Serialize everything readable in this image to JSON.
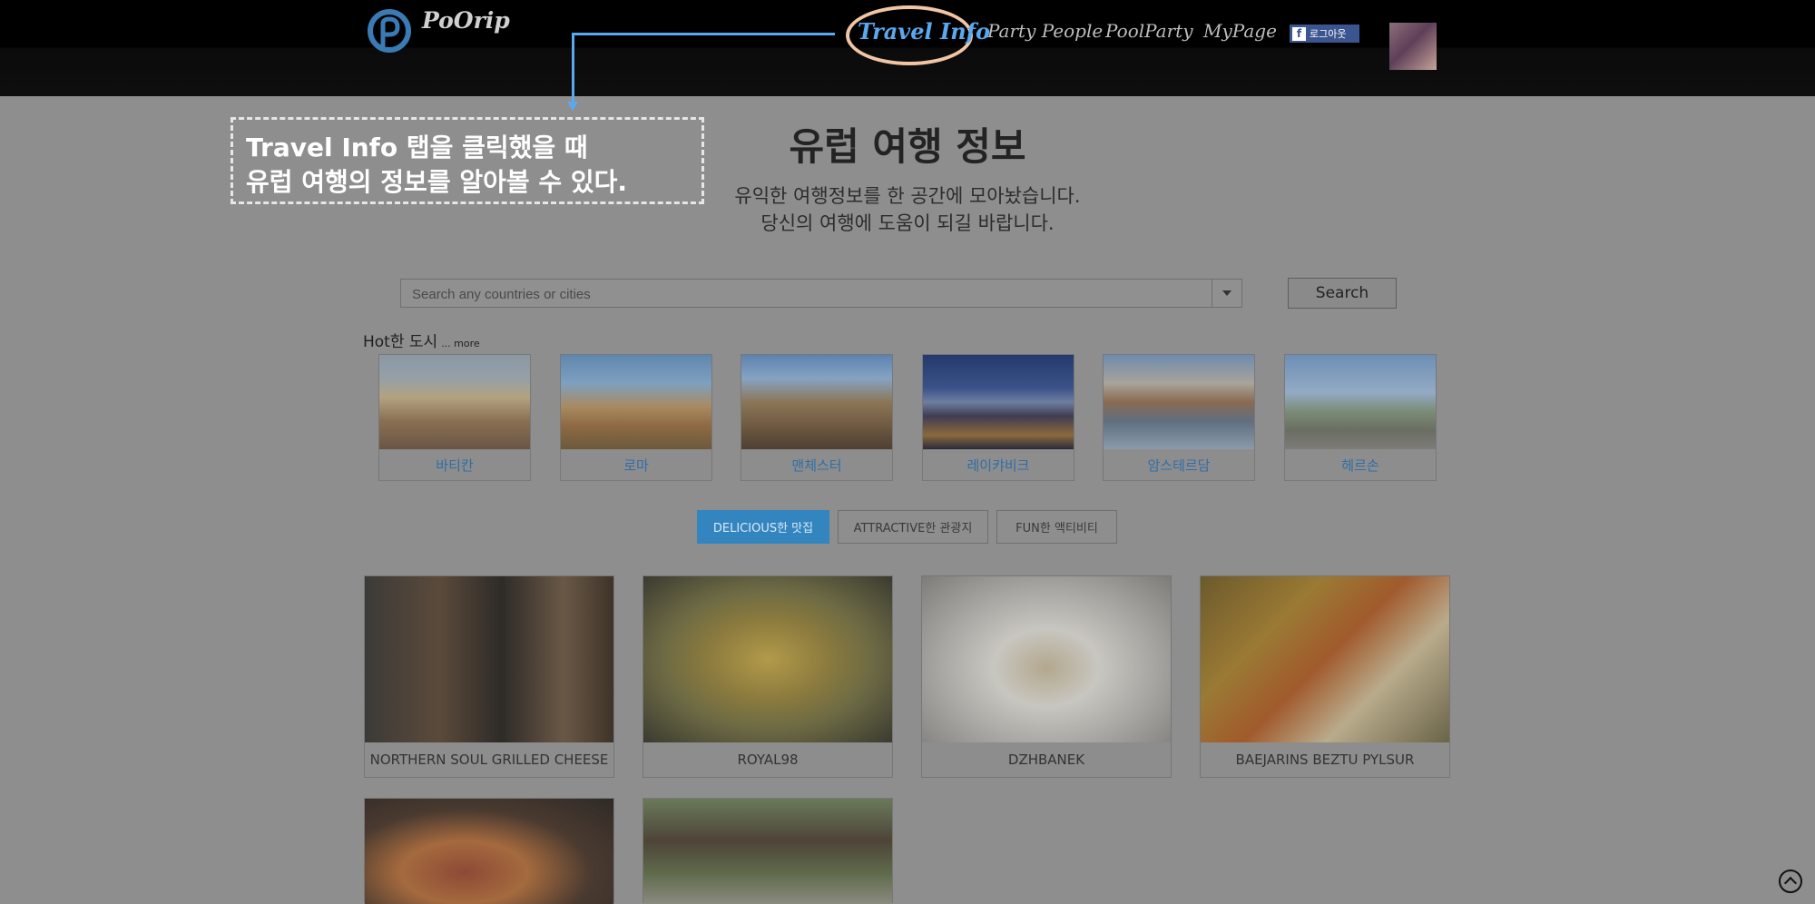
{
  "brand": {
    "name": "PoOrip",
    "logo_icon": "p-logo-icon"
  },
  "nav": {
    "items": [
      "Travel Info",
      "Party People",
      "PoolParty",
      "MyPage"
    ],
    "active": "Travel Info",
    "logout_label": "로그아웃"
  },
  "callout": {
    "line1": "Travel Info 탭을 클릭했을 때",
    "line2": "유럽 여행의 정보를 알아볼 수 있다."
  },
  "header": {
    "title": "유럽 여행 정보",
    "subtitle_line1": "유익한 여행정보를 한 공간에 모아놨습니다.",
    "subtitle_line2": "당신의 여행에 도움이 되길 바랍니다."
  },
  "search": {
    "placeholder": "Search any countries or cities",
    "button_label": "Search"
  },
  "hot_cities": {
    "label": "Hot한 도시",
    "more_label": "... more",
    "items": [
      "바티칸",
      "로마",
      "맨체스터",
      "레이캬비크",
      "암스테르담",
      "헤르손"
    ]
  },
  "tabs": {
    "items": [
      "DELICIOUS한 맛집",
      "ATTRACTIVE한 관광지",
      "FUN한 액티비티"
    ],
    "active_index": 0
  },
  "restaurants": [
    "NORTHERN SOUL GRILLED CHEESE",
    "ROYAL98",
    "DZHBANEK",
    "BAEJARINS BEZTU PYLSUR",
    "",
    ""
  ],
  "colors": {
    "accent": "#5aa8ef",
    "active_tab": "#3385c0",
    "overlay_bg": "#8e8e8e",
    "highlight_ring": "#f1c6a5"
  }
}
